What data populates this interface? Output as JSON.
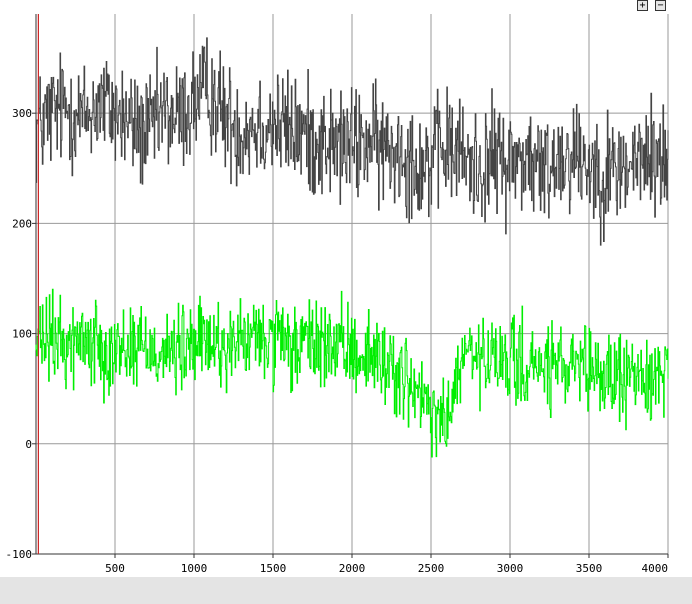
{
  "toolbar": {
    "zoom_in_label": "+",
    "zoom_out_label": "−"
  },
  "chart_data": {
    "type": "line",
    "title": "",
    "xlabel": "",
    "ylabel": "",
    "xlim": [
      0,
      4000
    ],
    "ylim": [
      -100,
      390
    ],
    "grid": true,
    "x_ticks": [
      500,
      1000,
      1500,
      2000,
      2500,
      3000,
      3500,
      4000
    ],
    "y_ticks": [
      -100,
      0,
      100,
      200,
      300
    ],
    "marker_x": 15,
    "series": [
      {
        "color": "#444444",
        "x": [
          0,
          100,
          200,
          300,
          400,
          500,
          600,
          700,
          800,
          900,
          1000,
          1100,
          1200,
          1300,
          1400,
          1500,
          1600,
          1700,
          1800,
          1900,
          2000,
          2100,
          2200,
          2300,
          2400,
          2500,
          2600,
          2700,
          2800,
          2900,
          3000,
          3100,
          3200,
          3300,
          3400,
          3500,
          3600,
          3700,
          3800,
          3900,
          4000
        ],
        "values": [
          285,
          300,
          305,
          295,
          310,
          300,
          290,
          280,
          300,
          295,
          310,
          320,
          295,
          285,
          290,
          290,
          285,
          280,
          275,
          270,
          270,
          275,
          265,
          270,
          255,
          255,
          270,
          260,
          250,
          260,
          255,
          260,
          245,
          260,
          265,
          255,
          245,
          250,
          255,
          260,
          255
        ],
        "noise_amplitude": 40
      },
      {
        "color": "#00ee00",
        "x": [
          0,
          100,
          200,
          300,
          400,
          500,
          600,
          700,
          800,
          900,
          1000,
          1100,
          1200,
          1300,
          1400,
          1500,
          1600,
          1700,
          1800,
          1900,
          2000,
          2100,
          2200,
          2300,
          2400,
          2500,
          2600,
          2700,
          2800,
          2900,
          3000,
          3100,
          3200,
          3300,
          3400,
          3500,
          3600,
          3700,
          3800,
          3900,
          4000
        ],
        "values": [
          90,
          95,
          90,
          95,
          90,
          85,
          90,
          88,
          85,
          82,
          90,
          92,
          88,
          92,
          95,
          92,
          85,
          90,
          92,
          85,
          85,
          80,
          75,
          65,
          45,
          25,
          20,
          80,
          75,
          72,
          75,
          70,
          68,
          70,
          65,
          62,
          62,
          60,
          60,
          62,
          70
        ],
        "noise_amplitude": 30
      }
    ]
  }
}
